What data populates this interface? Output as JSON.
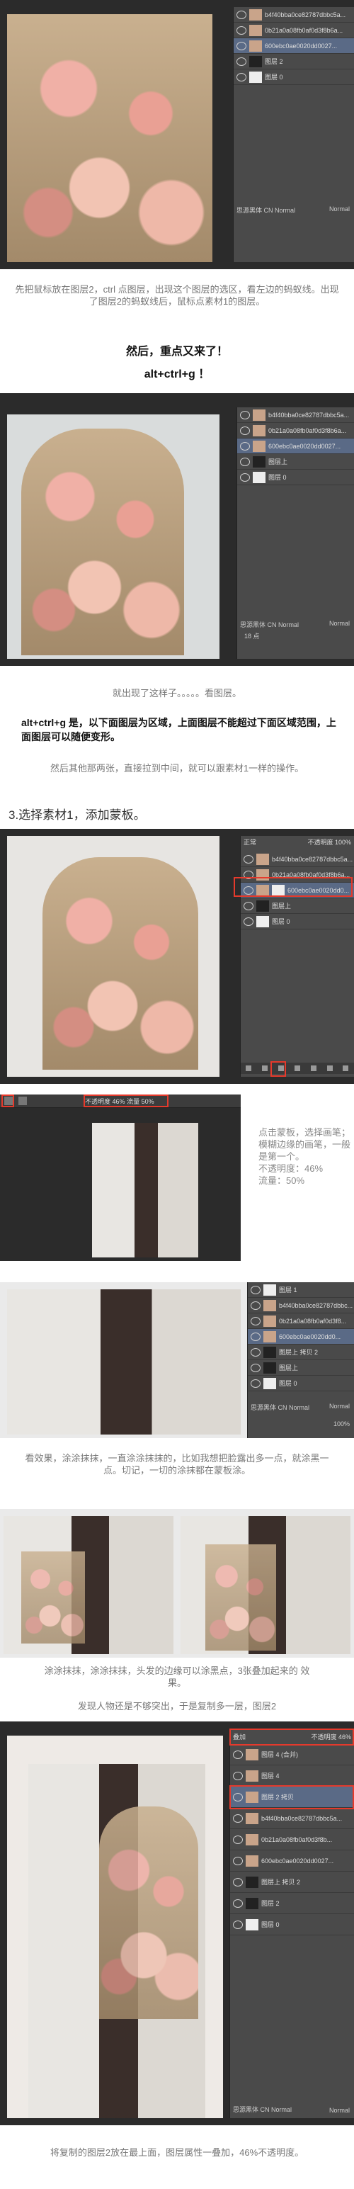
{
  "screenshot1": {
    "layers": [
      "b4f40bba0ce82787dbbc5a...",
      "0b21a0a08fb0af0d3f8b6a...",
      "600ebc0ae0020dd0027...",
      "图层 2",
      "图层 0"
    ],
    "selected_index": 2,
    "font_name": "思源黑体 CN Normal",
    "font_style": "Normal"
  },
  "caption1": "先把鼠标放在图层2，ctrl 点图层，出现这个图层的选区，看左边的蚂蚁线。出现了图层2的蚂蚁线后，鼠标点素材1的图层。",
  "caption2a": "然后，重点又来了！",
  "caption2b": "alt+ctrl+g ！",
  "screenshot2": {
    "layers": [
      "b4f40bba0ce82787dbbc5a...",
      "0b21a0a08fb0af0d3f8b6a...",
      "600ebc0ae0020dd0027...",
      "图层上",
      "图层 0"
    ],
    "selected_index": 2,
    "font_name": "思源黑体 CN Normal",
    "font_style": "Normal",
    "size": "18 点"
  },
  "caption3": "就出现了这样子。。。。。看图层。",
  "caption4": "alt+ctrl+g 是，以下面图层为区域，上面图层不能超过下面区域范围，上面图层可以随便变形。",
  "caption5": "然后其他那两张，直接拉到中间，就可以跟素材1一样的操作。",
  "section_title": "3.选择素材1，添加蒙板。",
  "screenshot3": {
    "blend_mode": "正常",
    "opacity_label": "不透明度",
    "opacity": "100%",
    "layers": [
      "b4f40bba0ce82787dbbc5a...",
      "0b21a0a08fb0af0d3f8b6a...",
      "600ebc0ae0020dd0...",
      "图层上",
      "图层 0"
    ]
  },
  "screenshot4": {
    "opacity_label": "不透明度",
    "opacity": "46%",
    "flow_label": "流量",
    "flow": "50%"
  },
  "side_text": {
    "line1": "点击蒙板，选择画笔；",
    "line2": "模糊边缘的画笔，一般",
    "line3": "是第一个。",
    "line4": "不透明度：46%",
    "line5": "流量：50%"
  },
  "screenshot5": {
    "layers": [
      "图层 1",
      "b4f40bba0ce82787dbbc...",
      "0b21a0a08fb0af0d3f8...",
      "600ebc0ae0020dd0...",
      "图层上 拷贝 2",
      "图层上",
      "图层 0"
    ],
    "font_name": "思源黑体 CN Normal",
    "font_style": "Normal",
    "opacity": "100%"
  },
  "caption6": "看效果，涂涂抹抹，一直涂涂抹抹的，比如我想把脸露出多一点，就涂黑一点。切记，一切的涂抹都在蒙板涂。",
  "caption7": "涂涂抹抹，涂涂抹抹，头发的边缘可以涂黑点，3张叠加起来的 效果。",
  "caption8": "发现人物还是不够突出，于是复制多一层，图层2",
  "screenshot7": {
    "blend_mode": "叠加",
    "opacity_label": "不透明度",
    "opacity": "46%",
    "layers": [
      "图层 4 (合并)",
      "图层 4",
      "图层 2 拷贝",
      "b4f40bba0ce82787dbbc5a...",
      "0b21a0a08fb0af0d3f8b...",
      "600ebc0ae0020dd0027...",
      "图层上 拷贝 2",
      "图层 2",
      "图层 0"
    ],
    "selected_index": 2,
    "font_name": "思源黑体 CN Normal",
    "font_style": "Normal"
  },
  "caption9": "将复制的图层2放在最上面，图层属性一叠加，46%不透明度。"
}
